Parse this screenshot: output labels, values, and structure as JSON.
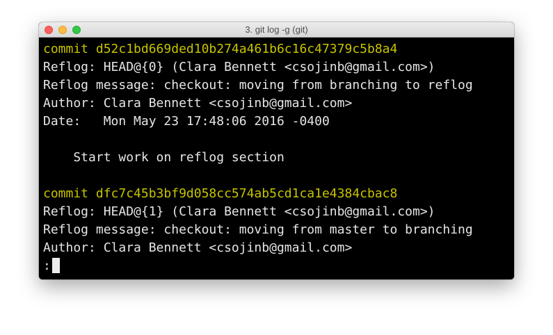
{
  "window": {
    "title": "3. git log -g (git)"
  },
  "colors": {
    "commit_hash": "#c7c400",
    "text": "#e6e6e6",
    "background": "#000000"
  },
  "terminal": {
    "entry1": {
      "commit": "commit d52c1bd669ded10b274a461b6c16c47379c5b8a4",
      "reflog": "Reflog: HEAD@{0} (Clara Bennett <csojinb@gmail.com>)",
      "message": "Reflog message: checkout: moving from branching to reflog",
      "author": "Author: Clara Bennett <csojinb@gmail.com>",
      "date": "Date:   Mon May 23 17:48:06 2016 -0400",
      "body": "    Start work on reflog section"
    },
    "entry2": {
      "commit": "commit dfc7c45b3bf9d058cc574ab5cd1ca1e4384cbac8",
      "reflog": "Reflog: HEAD@{1} (Clara Bennett <csojinb@gmail.com>)",
      "message": "Reflog message: checkout: moving from master to branching",
      "author": "Author: Clara Bennett <csojinb@gmail.com>"
    },
    "prompt": ":"
  }
}
